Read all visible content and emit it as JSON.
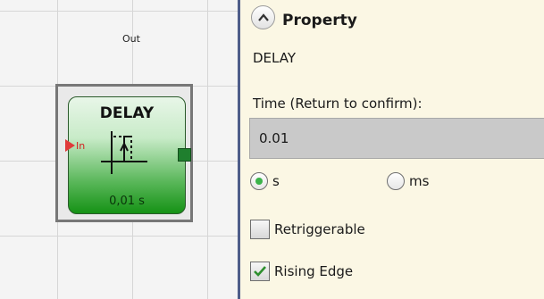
{
  "canvas": {
    "block": {
      "title": "DELAY",
      "input_label": "In",
      "output_label": "Out",
      "value": "0,01 s",
      "symbol_icon": "rising-edge-delay-icon",
      "colors": {
        "top": "#e8f6e8",
        "bottom": "#159215",
        "input_arrow": "#e03a3a",
        "output_port": "#1f7f2e"
      }
    }
  },
  "panel": {
    "collapse_icon": "chevron-up-icon",
    "title": "Property",
    "component_name": "DELAY",
    "time_label": "Time (Return to confirm):",
    "time_value": "0.01",
    "units": [
      {
        "label": "s",
        "selected": true
      },
      {
        "label": "ms",
        "selected": false
      }
    ],
    "options": [
      {
        "label": "Retriggerable",
        "checked": false
      },
      {
        "label": "Rising Edge",
        "checked": true
      }
    ],
    "colors": {
      "background": "#fbf7e4",
      "border": "#4e5d8a",
      "input_bg": "#c9c9c9",
      "radio_dot": "#3bb34a"
    }
  }
}
